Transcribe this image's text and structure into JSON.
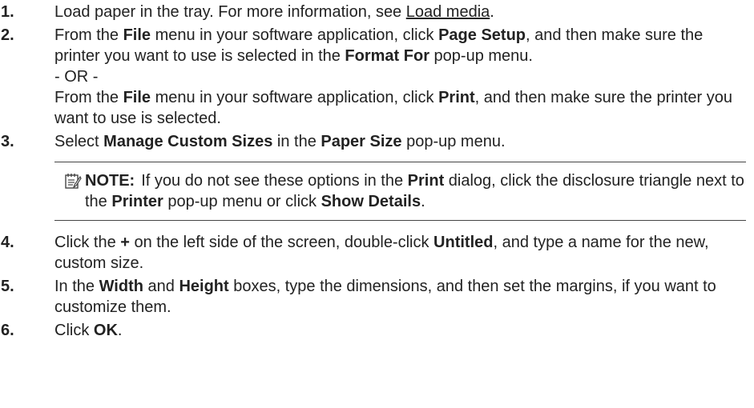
{
  "steps": [
    {
      "num": "1.",
      "parts": [
        "Load paper in the tray. For more information, see ",
        "Load media",
        "."
      ]
    },
    {
      "num": "2.",
      "a": [
        "From the ",
        "File",
        " menu in your software application, click ",
        "Page Setup",
        ", and then make sure the printer you want to use is selected in the ",
        "Format For",
        " pop-up menu."
      ],
      "or": "- OR -",
      "b": [
        "From the ",
        "File",
        " menu in your software application, click ",
        "Print",
        ", and then make sure the printer you want to use is selected."
      ]
    },
    {
      "num": "3.",
      "parts": [
        "Select ",
        "Manage Custom Sizes",
        " in the ",
        "Paper Size",
        " pop-up menu."
      ]
    },
    {
      "num": "4.",
      "parts": [
        "Click the ",
        "+",
        " on the left side of the screen, double-click ",
        "Untitled",
        ", and type a name for the new, custom size."
      ]
    },
    {
      "num": "5.",
      "parts": [
        "In the ",
        "Width",
        " and ",
        "Height",
        " boxes, type the dimensions, and then set the margins, if you want to customize them."
      ]
    },
    {
      "num": "6.",
      "parts": [
        "Click ",
        "OK",
        "."
      ]
    }
  ],
  "note": {
    "icon": "note-pad-icon",
    "label": "NOTE:",
    "parts": [
      "If you do not see these options in the ",
      "Print",
      " dialog, click the disclosure triangle next to the ",
      "Printer",
      " pop-up menu or click ",
      "Show Details",
      "."
    ]
  }
}
